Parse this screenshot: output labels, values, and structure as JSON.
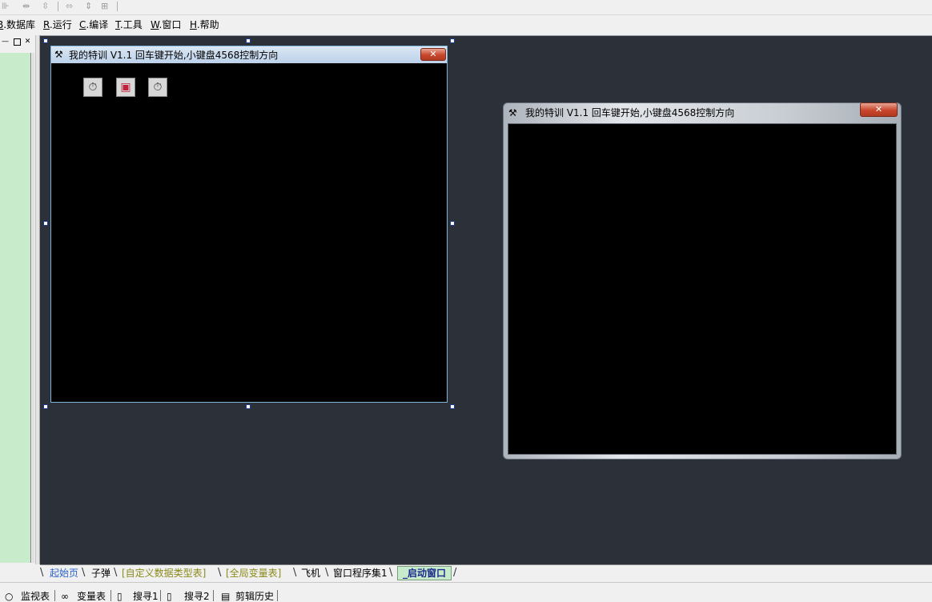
{
  "toolbar": {
    "icons": [
      "align-icon",
      "distribute-horizontal-icon",
      "distribute-vertical-icon",
      "same-width-icon",
      "same-height-icon",
      "same-size-icon"
    ]
  },
  "menu": {
    "items": [
      {
        "key": "B",
        "rest": ".数据库"
      },
      {
        "key": "R",
        "rest": ".运行"
      },
      {
        "key": "C",
        "rest": ".编译"
      },
      {
        "key": "T",
        "rest": ".工具"
      },
      {
        "key": "W",
        "rest": ".窗口"
      },
      {
        "key": "H",
        "rest": ".帮助"
      }
    ]
  },
  "design_window": {
    "title": "我的特训 V1.1 回车键开始,小键盘4568控制方向",
    "close_glyph": "✕",
    "components": [
      "timer-icon",
      "picture-box-icon",
      "timer-icon"
    ]
  },
  "preview_window": {
    "title": "我的特训 V1.1 回车键开始,小键盘4568控制方向",
    "close_glyph": "✕"
  },
  "left_panel": {
    "min_glyph": "—",
    "max_glyph": "□",
    "close_glyph": "✕"
  },
  "tabs": [
    {
      "label": "起始页",
      "color": "#2a63c8"
    },
    {
      "label": "子弹",
      "color": "#000000"
    },
    {
      "label": "[自定义数据类型表]",
      "color": "#8a8a1a"
    },
    {
      "label": "[全局变量表]",
      "color": "#8a8a1a"
    },
    {
      "label": "飞机",
      "color": "#000000"
    },
    {
      "label": "窗口程序集1",
      "color": "#000000"
    },
    {
      "label": "_启动窗口",
      "color": "#1b2a8c",
      "active": true
    }
  ],
  "status": {
    "items": [
      "监视表",
      "变量表",
      "搜寻1",
      "搜寻2",
      "剪辑历史"
    ]
  },
  "colors": {
    "workspace": "#2b3039",
    "left_panel": "#c8ebcc",
    "active_tab_bg": "#c8ebcc"
  }
}
